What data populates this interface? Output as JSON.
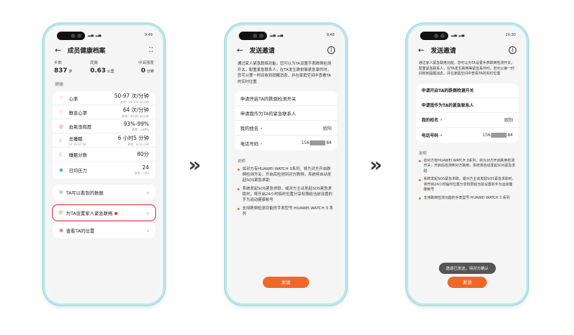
{
  "phone1": {
    "status_left": "··· ▐▌▐▌",
    "status_right": "9:49",
    "title": "成员健康档案",
    "menu_icon": "more-icon",
    "stats": [
      {
        "label": "步数",
        "value": "837",
        "unit": "步"
      },
      {
        "label": "距离",
        "value": "0.63",
        "unit": "公里"
      },
      {
        "label": "中高强度",
        "value": "0",
        "unit": "分钟"
      }
    ],
    "section": "健康",
    "health": [
      {
        "name": "心率",
        "sub": "",
        "value": "50-97 次/分钟",
        "ref": "参考：40-220 次/分钟",
        "icon": "heart-icon"
      },
      {
        "name": "静息心率",
        "sub": "",
        "value": "64 次/分钟",
        "ref": "参考：60-80 次/分钟",
        "icon": "heart-icon"
      },
      {
        "name": "血氧饱和度",
        "sub": "",
        "value": "93%-99%",
        "ref": "参考：≥90%",
        "icon": "oxygen-icon"
      },
      {
        "name": "总睡眠",
        "sub": "01:43-07:58",
        "value": "6 小时5 分钟",
        "ref": "参考：6-10 小时",
        "icon": "sleep-icon"
      },
      {
        "name": "睡眠分数",
        "sub": "",
        "value": "80分",
        "ref": "",
        "icon": "sleep-score-icon"
      },
      {
        "name": "日均压力",
        "sub": "",
        "value": "24",
        "ref": "参考：<60",
        "icon": "stress-icon"
      }
    ],
    "link_data": "TA可以看到的数据",
    "link_emergency": "为TA设置家人紧急联络",
    "link_location": "查看TA的位置"
  },
  "phone2": {
    "status_right": "9:48",
    "title": "发送邀请",
    "intro": "通过家人紧急联络功能，您可以为TA设置手表跌倒检测开关，配置紧急联系人，在TA发生跌倒事紧急事件时，您可以第一时间收到提醒消息，并在家庭空间中查看TA的实时位置",
    "rows": [
      {
        "label": "申请开启TA的跌倒检测开关"
      },
      {
        "label": "申请我作为TA的紧急联系人"
      }
    ],
    "name_label": "我的姓名",
    "name_value": "欧阳",
    "phone_label": "电话号码",
    "phone_prefix": "156",
    "phone_suffix": "84",
    "notes_title": "说明",
    "notes": [
      "如对方有HUAWEI WATCH 3系列，将为对方开启跌倒检测开关，开启后检测到对方跌倒，系统将自动发起SOS紧急求助",
      "系统发起SOS紧急求助，或对方主动发起SOS紧急求助时，将开启24小时临时位置分享权限给当前设置的手为运动健康帐号",
      "支持跌倒检测功能的手表型号:HUAWEI WATCH 3 系列"
    ],
    "send": "发送"
  },
  "phone3": {
    "status_right": "20:30",
    "title": "发送邀请",
    "intro": "通过家人紧急联络功能，您可以为TA设置手表跌倒检测开关，配置紧急联系人，在TA发生跌倒等紧急事件时，您可以第一时间收到提醒消息，并在家庭空间中查看TA的实时位置",
    "rows": [
      {
        "label": "申请开启TA的跌倒检测开关"
      },
      {
        "label": "申请我作为TA的紧急联系人"
      }
    ],
    "name_label": "我的姓名",
    "name_value": "欧阳",
    "phone_label": "电话号码",
    "phone_prefix": "156",
    "phone_suffix": "84",
    "notes_title": "说明",
    "notes": [
      "如对方有HUAWEI WATCH 3系列，将为对方开启跌倒检测开关，开启后检测到对方跌倒，系统将自动发起SOS紧急求助",
      "系统发起SOS紧急求助，或对方主动发起SOS紧急求助时，将开启24小时临时位置分享权限给当前设置的手为运动健康帐号",
      "支持跌倒检测功能的手表型号:HUAWEI WATCH 3 系列"
    ],
    "toast": "邀请已发送，待对方确认",
    "send": "发送"
  },
  "arrows": [
    "»",
    "»"
  ]
}
